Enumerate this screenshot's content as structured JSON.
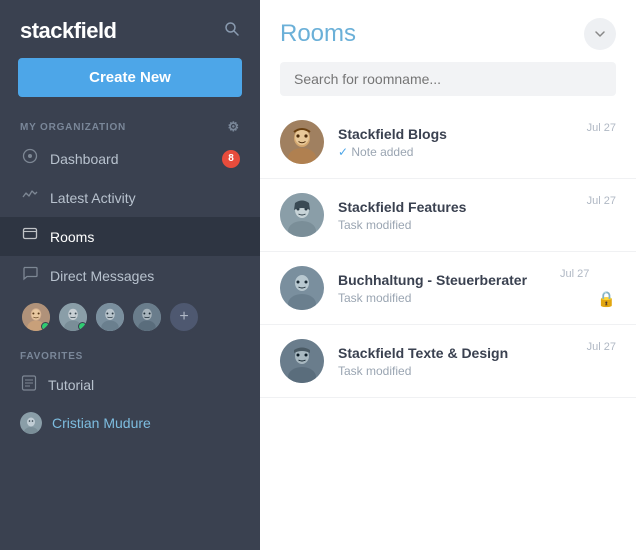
{
  "app": {
    "name": "stackfield",
    "title": "stackfield"
  },
  "sidebar": {
    "create_button_label": "Create New",
    "section_org_label": "MY ORGANIZATION",
    "nav_items": [
      {
        "id": "dashboard",
        "label": "Dashboard",
        "icon": "⊙",
        "badge": "8"
      },
      {
        "id": "latest-activity",
        "label": "Latest Activity",
        "icon": "∿",
        "badge": null
      },
      {
        "id": "rooms",
        "label": "Rooms",
        "icon": "🖥",
        "badge": null,
        "active": true
      },
      {
        "id": "direct-messages",
        "label": "Direct Messages",
        "icon": "💬",
        "badge": null
      }
    ],
    "favorites_label": "FAVORITES",
    "favorites": [
      {
        "id": "tutorial",
        "label": "Tutorial",
        "icon": "fav-icon"
      },
      {
        "id": "cristian-mudure",
        "label": "Cristian Mudure",
        "icon": "avatar"
      }
    ]
  },
  "rooms_panel": {
    "title": "Rooms",
    "search_placeholder": "Search for roomname...",
    "rooms": [
      {
        "id": "stackfield-blogs",
        "name": "Stackfield Blogs",
        "sub": "Note added",
        "sub_type": "check",
        "date": "Jul 27",
        "lock": false
      },
      {
        "id": "stackfield-features",
        "name": "Stackfield Features",
        "sub": "Task modified",
        "sub_type": "normal",
        "date": "Jul 27",
        "lock": false
      },
      {
        "id": "buchhaltung",
        "name": "Buchhaltung - Steuerberater",
        "sub": "Task modified",
        "sub_type": "normal",
        "date": "Jul 27",
        "lock": true
      },
      {
        "id": "stackfield-texte",
        "name": "Stackfield Texte & Design",
        "sub": "Task modified",
        "sub_type": "normal",
        "date": "Jul 27",
        "lock": false
      }
    ]
  }
}
